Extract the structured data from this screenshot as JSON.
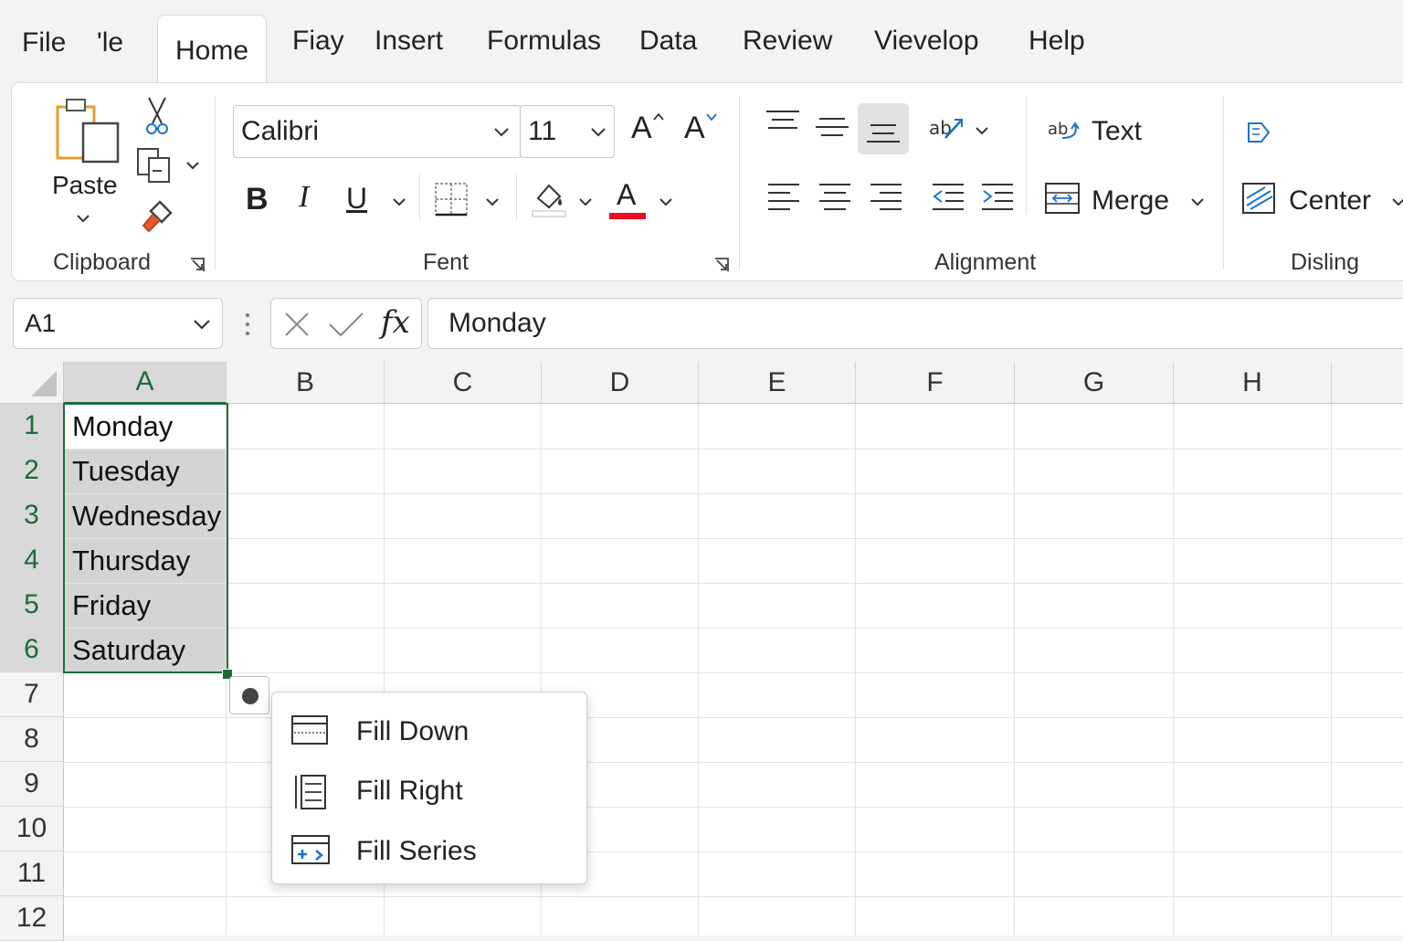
{
  "menu": {
    "tabs": [
      "File",
      "'le",
      "Home",
      "Fiay",
      "Insert",
      "Formulas",
      "Data",
      "Review",
      "Vievelop",
      "Help"
    ],
    "active_tab": "Home"
  },
  "ribbon": {
    "clipboard": {
      "paste_label": "Paste",
      "group_label": "Clipboard"
    },
    "font": {
      "font_name": "Calibri",
      "font_size": "11",
      "grow_label": "A",
      "shrink_label": "A",
      "bold_label": "B",
      "italic_label": "I",
      "underline_label": "U",
      "font_color_label": "A",
      "font_color": "#e81123",
      "group_label": "Fent"
    },
    "alignment": {
      "wrap_label": "Text",
      "merge_label": "Merge",
      "group_label": "Alignment"
    },
    "styles": {
      "center_label": "Center",
      "group_label": "Disling"
    }
  },
  "formula_bar": {
    "name_box": "A1",
    "fx_label": "fx",
    "content": "Monday"
  },
  "grid": {
    "columns": [
      "A",
      "B",
      "C",
      "D",
      "E",
      "F",
      "G",
      "H"
    ],
    "rows": [
      "1",
      "2",
      "3",
      "4",
      "5",
      "6",
      "7",
      "8",
      "9",
      "10",
      "11",
      "12"
    ],
    "column_a_values": [
      "Monday",
      "Tuesday",
      "Wednesday",
      "Thursday",
      "Friday",
      "Saturday"
    ],
    "selection_color": "#1e6b3a"
  },
  "autofill_menu": {
    "items": [
      "Fill Down",
      "Fill Right",
      "Fill Series"
    ]
  }
}
